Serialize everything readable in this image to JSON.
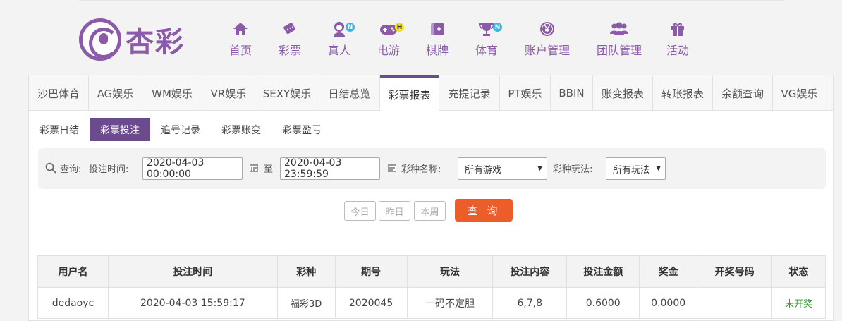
{
  "brand": {
    "name": "杏彩"
  },
  "nav": [
    {
      "label": "首页",
      "icon": "home-icon"
    },
    {
      "label": "彩票",
      "icon": "lottery-ticket-icon"
    },
    {
      "label": "真人",
      "icon": "live-dealer-icon",
      "badge": "N"
    },
    {
      "label": "电游",
      "icon": "gamepad-icon",
      "badge": "H"
    },
    {
      "label": "棋牌",
      "icon": "cards-icon"
    },
    {
      "label": "体育",
      "icon": "trophy-icon",
      "badge": "N"
    },
    {
      "label": "账户管理",
      "icon": "yen-coin-icon"
    },
    {
      "label": "团队管理",
      "icon": "team-icon"
    },
    {
      "label": "活动",
      "icon": "gift-icon"
    }
  ],
  "tabs": [
    "沙巴体育",
    "AG娱乐",
    "WM娱乐",
    "VR娱乐",
    "SEXY娱乐",
    "日结总览",
    "彩票报表",
    "充提记录",
    "PT娱乐",
    "BBIN",
    "账变报表",
    "转账报表",
    "余额查询",
    "VG娱乐"
  ],
  "active_tab": "彩票报表",
  "subtabs": [
    "彩票日结",
    "彩票投注",
    "追号记录",
    "彩票账变",
    "彩票盈亏"
  ],
  "active_subtab": "彩票投注",
  "query": {
    "label": "查询:",
    "time_label": "投注时间:",
    "start": "2020-04-03 00:00:00",
    "to": "至",
    "end": "2020-04-03 23:59:59",
    "game_label": "彩种名称:",
    "game_value": "所有游戏",
    "play_label": "彩种玩法:",
    "play_value": "所有玩法"
  },
  "quick": {
    "today": "今日",
    "yesterday": "昨日",
    "week": "本周",
    "search": "查 询"
  },
  "table": {
    "headers": [
      "用户名",
      "投注时间",
      "彩种",
      "期号",
      "玩法",
      "投注内容",
      "投注金额",
      "奖金",
      "开奖号码",
      "状态"
    ],
    "rows": [
      [
        "dedaoyc",
        "2020-04-03 15:59:17",
        "福彩3D",
        "2020045",
        "一码不定胆",
        "6,7,8",
        "0.6000",
        "0.0000",
        "",
        "未开奖"
      ]
    ]
  },
  "colors": {
    "brand": "#8b5aa8",
    "active": "#6c4a8e",
    "search_button": "#ed5d29",
    "status_pending": "#2a9d2a"
  }
}
